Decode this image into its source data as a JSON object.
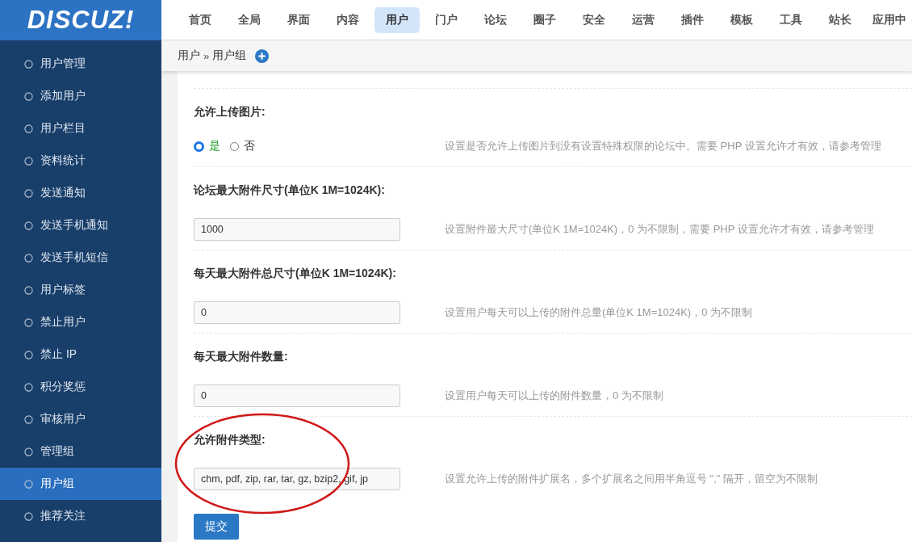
{
  "logo": "DISCUZ!",
  "nav": [
    {
      "label": "首页",
      "selected": false
    },
    {
      "label": "全局",
      "selected": false
    },
    {
      "label": "界面",
      "selected": false
    },
    {
      "label": "内容",
      "selected": false
    },
    {
      "label": "用户",
      "selected": true
    },
    {
      "label": "门户",
      "selected": false
    },
    {
      "label": "论坛",
      "selected": false
    },
    {
      "label": "圈子",
      "selected": false
    },
    {
      "label": "安全",
      "selected": false
    },
    {
      "label": "运营",
      "selected": false
    },
    {
      "label": "插件",
      "selected": false
    },
    {
      "label": "模板",
      "selected": false
    },
    {
      "label": "工具",
      "selected": false
    },
    {
      "label": "站长",
      "selected": false
    },
    {
      "label": "应用中",
      "selected": false
    }
  ],
  "sidebar": {
    "items": [
      {
        "label": "用户管理",
        "selected": false
      },
      {
        "label": "添加用户",
        "selected": false
      },
      {
        "label": "用户栏目",
        "selected": false
      },
      {
        "label": "资料统计",
        "selected": false
      },
      {
        "label": "发送通知",
        "selected": false
      },
      {
        "label": "发送手机通知",
        "selected": false
      },
      {
        "label": "发送手机短信",
        "selected": false
      },
      {
        "label": "用户标签",
        "selected": false
      },
      {
        "label": "禁止用户",
        "selected": false
      },
      {
        "label": "禁止 IP",
        "selected": false
      },
      {
        "label": "积分奖惩",
        "selected": false
      },
      {
        "label": "审核用户",
        "selected": false
      },
      {
        "label": "管理组",
        "selected": false
      },
      {
        "label": "用户组",
        "selected": true
      },
      {
        "label": "推荐关注",
        "selected": false
      }
    ]
  },
  "breadcrumb": {
    "items": [
      "用户",
      "用户组"
    ],
    "separator": "»"
  },
  "settings": [
    {
      "kind": "radio",
      "label": "允许上传图片:",
      "options": [
        {
          "label": "是",
          "selected": true
        },
        {
          "label": "否",
          "selected": false
        }
      ],
      "hint": "设置是否允许上传图片到没有设置特殊权限的论坛中。需要 PHP 设置允许才有效，请参考管理",
      "circled": false
    },
    {
      "kind": "input",
      "label": "论坛最大附件尺寸(单位K 1M=1024K):",
      "value": "1000",
      "hint": "设置附件最大尺寸(单位K 1M=1024K)，0 为不限制，需要 PHP 设置允许才有效，请参考管理",
      "circled": false
    },
    {
      "kind": "input",
      "label": "每天最大附件总尺寸(单位K 1M=1024K):",
      "value": "0",
      "hint": "设置用户每天可以上传的附件总量(单位K 1M=1024K)，0 为不限制",
      "circled": false
    },
    {
      "kind": "input",
      "label": "每天最大附件数量:",
      "value": "0",
      "hint": "设置用户每天可以上传的附件数量，0 为不限制",
      "circled": false
    },
    {
      "kind": "input",
      "label": "允许附件类型:",
      "value": "chm, pdf, zip, rar, tar, gz, bzip2, gif, jp",
      "hint": "设置允许上传的附件扩展名，多个扩展名之间用半角逗号 \",\" 隔开，留空为不限制",
      "circled": true
    }
  ],
  "submit": "提交"
}
